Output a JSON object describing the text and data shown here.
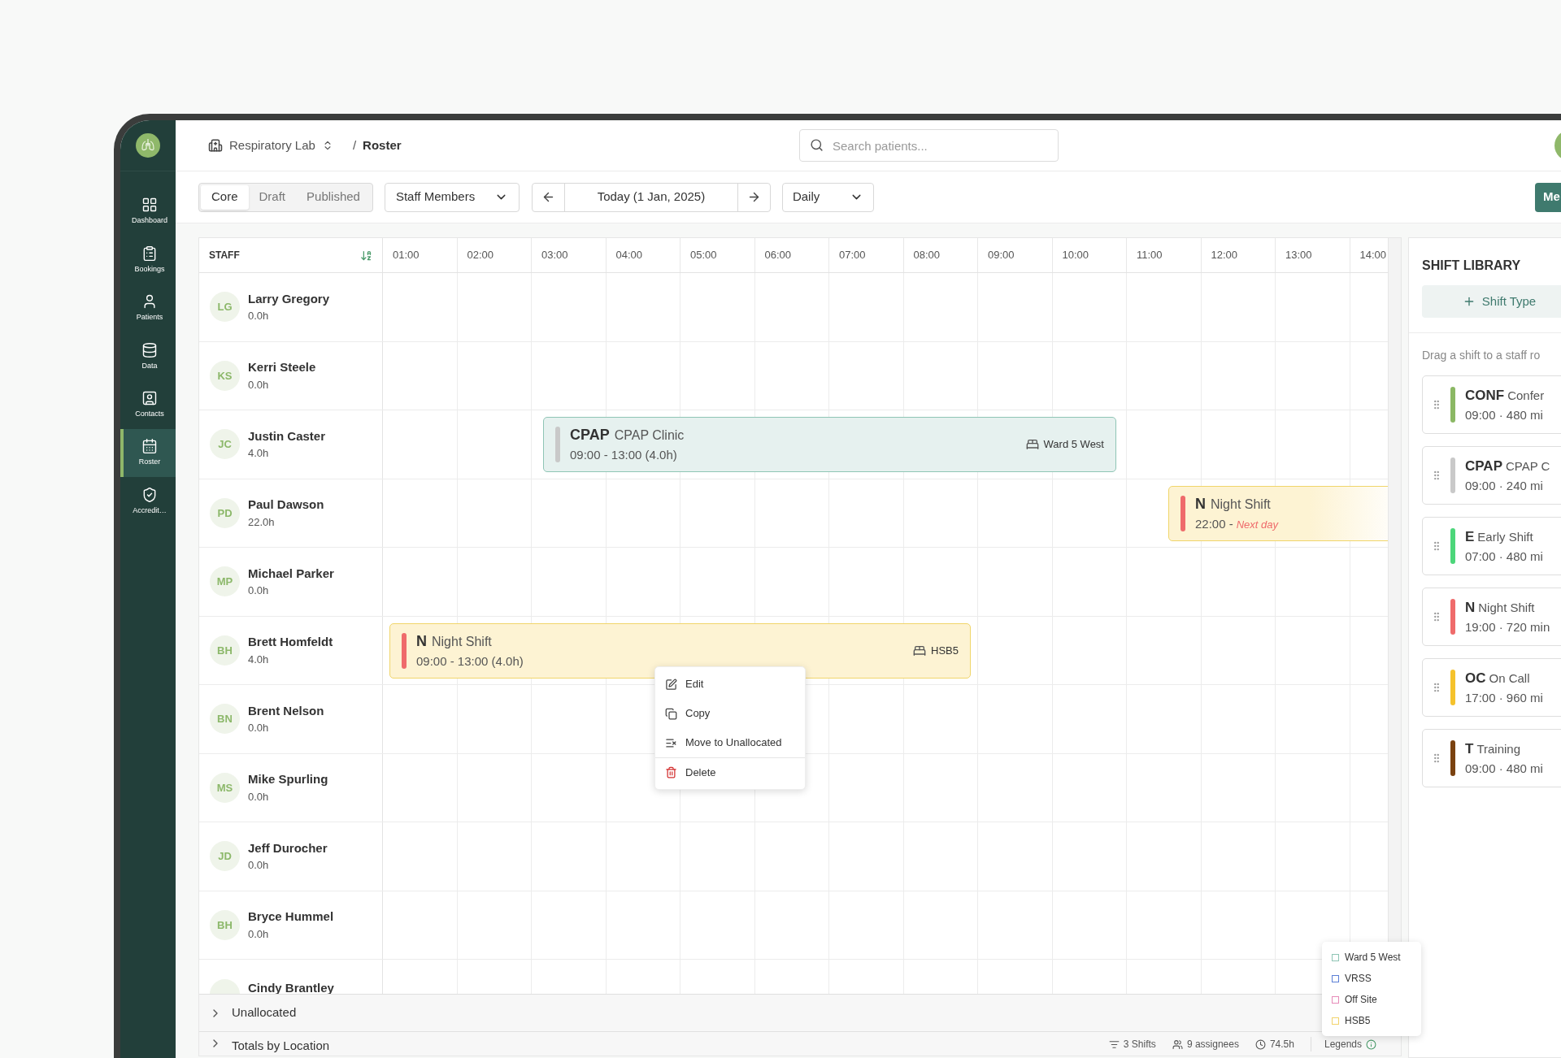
{
  "sidebar": {
    "nav": [
      {
        "label": "Dashboard",
        "kind": "dashboard",
        "selected": false
      },
      {
        "label": "Bookings",
        "kind": "bookings",
        "selected": false
      },
      {
        "label": "Patients",
        "kind": "patients",
        "selected": false
      },
      {
        "label": "Data",
        "kind": "data",
        "selected": false
      },
      {
        "label": "Contacts",
        "kind": "contacts",
        "selected": false
      },
      {
        "label": "Roster",
        "kind": "roster",
        "selected": true
      },
      {
        "label": "Accredit…",
        "kind": "accreditation",
        "selected": false
      }
    ]
  },
  "breadcrumb": {
    "location": "Respiratory Lab",
    "separator": "/",
    "page": "Roster"
  },
  "search": {
    "placeholder": "Search patients..."
  },
  "toolbar": {
    "views": [
      {
        "label": "Core",
        "selected": true
      },
      {
        "label": "Draft",
        "selected": false
      },
      {
        "label": "Published",
        "selected": false
      }
    ],
    "group_by": "Staff Members",
    "date": "Today (1 Jan, 2025)",
    "period": "Daily",
    "action_button": "Me"
  },
  "roster": {
    "staff_header": "STAFF",
    "hours": [
      "01:00",
      "02:00",
      "03:00",
      "04:00",
      "05:00",
      "06:00",
      "07:00",
      "08:00",
      "09:00",
      "10:00",
      "11:00",
      "12:00",
      "13:00",
      "14:00"
    ],
    "staff": [
      {
        "initials": "LG",
        "name": "Larry Gregory",
        "hours": "0.0h"
      },
      {
        "initials": "KS",
        "name": "Kerri Steele",
        "hours": "0.0h"
      },
      {
        "initials": "JC",
        "name": "Justin Caster",
        "hours": "4.0h",
        "shifts": [
          {
            "code": "CPAP",
            "name": "CPAP Clinic",
            "time": "09:00 - 13:00 (4.0h)",
            "location": "Ward 5 West",
            "kind": "ward",
            "color": "#c9c9c9"
          }
        ]
      },
      {
        "initials": "PD",
        "name": "Paul Dawson",
        "hours": "22.0h",
        "shifts": [
          {
            "code": "N",
            "name": "Night Shift",
            "time": "22:00 -",
            "note": "Next day",
            "kind": "hsb",
            "color": "#ef6b6b"
          }
        ]
      },
      {
        "initials": "MP",
        "name": "Michael Parker",
        "hours": "0.0h"
      },
      {
        "initials": "BH",
        "name": "Brett Homfeldt",
        "hours": "4.0h",
        "shifts": [
          {
            "code": "N",
            "name": "Night Shift",
            "time": "09:00 - 13:00 (4.0h)",
            "location": "HSB5",
            "kind": "hsb",
            "color": "#ef6b6b"
          }
        ]
      },
      {
        "initials": "BN",
        "name": "Brent Nelson",
        "hours": "0.0h"
      },
      {
        "initials": "MS",
        "name": "Mike Spurling",
        "hours": "0.0h"
      },
      {
        "initials": "JD",
        "name": "Jeff Durocher",
        "hours": "0.0h"
      },
      {
        "initials": "BH",
        "name": "Bryce Hummel",
        "hours": "0.0h"
      },
      {
        "name": "Cindy Brantley"
      }
    ]
  },
  "context_menu": {
    "items": [
      {
        "label": "Edit",
        "kind": "edit"
      },
      {
        "label": "Copy",
        "kind": "copy"
      },
      {
        "label": "Move to Unallocated",
        "kind": "move"
      },
      {
        "label": "Delete",
        "kind": "delete"
      }
    ]
  },
  "unallocated": {
    "label": "Unallocated",
    "expanded": false
  },
  "totals": {
    "label": "Totals by Location",
    "expanded": false,
    "stats": [
      {
        "kind": "shifts",
        "text": "3 Shifts"
      },
      {
        "kind": "assignees",
        "text": "9 assignees"
      },
      {
        "kind": "hours",
        "text": "74.5h"
      }
    ],
    "legends_label": "Legends"
  },
  "legend": [
    {
      "label": "Ward 5 West",
      "color": "#8fc5b5"
    },
    {
      "label": "VRSS",
      "color": "#5b7fd6"
    },
    {
      "label": "Off Site",
      "color": "#e68ab8"
    },
    {
      "label": "HSB5",
      "color": "#f2d36b"
    }
  ],
  "shift_library": {
    "title": "SHIFT LIBRARY",
    "add_button": "Shift Type",
    "hint": "Drag a shift to a staff ro",
    "shifts": [
      {
        "code": "CONF",
        "name": "Confer",
        "details": "09:00 · 480 mi",
        "color": "#8bb864"
      },
      {
        "code": "CPAP",
        "name": "CPAP C",
        "details": "09:00 · 240 mi",
        "color": "#c9c9c9"
      },
      {
        "code": "E",
        "name": "Early Shift",
        "details": "07:00 · 480 mi",
        "color": "#4cd67a"
      },
      {
        "code": "N",
        "name": "Night Shift",
        "details": "19:00 · 720 min",
        "color": "#ef6b6b"
      },
      {
        "code": "OC",
        "name": "On Call",
        "details": "17:00 · 960 mi",
        "color": "#f5c22c"
      },
      {
        "code": "T",
        "name": "Training",
        "details": "09:00 · 480 mi",
        "color": "#7a4210"
      }
    ]
  }
}
